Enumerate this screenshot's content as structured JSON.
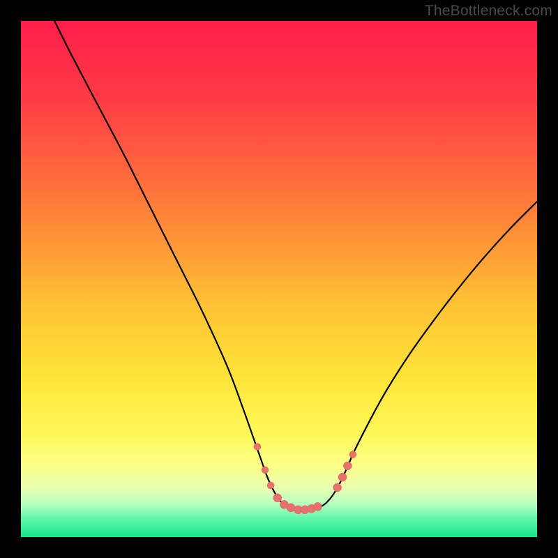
{
  "watermark": "TheBottleneck.com",
  "colors": {
    "black": "#000000",
    "curve": "#000000",
    "marker_fill": "#e9716b",
    "marker_stroke": "#d85f59"
  },
  "chart_data": {
    "type": "line",
    "title": "",
    "xlabel": "",
    "ylabel": "",
    "xlim": [
      0,
      100
    ],
    "ylim": [
      0,
      100
    ],
    "gradient_stops": [
      {
        "offset": 0.0,
        "color": "#ff1e49"
      },
      {
        "offset": 0.15,
        "color": "#ff3b45"
      },
      {
        "offset": 0.35,
        "color": "#ff7a3a"
      },
      {
        "offset": 0.55,
        "color": "#ffc233"
      },
      {
        "offset": 0.7,
        "color": "#ffe63a"
      },
      {
        "offset": 0.8,
        "color": "#fff85a"
      },
      {
        "offset": 0.86,
        "color": "#fdff87"
      },
      {
        "offset": 0.905,
        "color": "#e8ffb0"
      },
      {
        "offset": 0.935,
        "color": "#b8ffbf"
      },
      {
        "offset": 0.965,
        "color": "#5ef7a8"
      },
      {
        "offset": 1.0,
        "color": "#14e789"
      }
    ],
    "series": [
      {
        "name": "bottleneck-curve",
        "x": [
          6.5,
          10,
          15,
          20,
          25,
          30,
          35,
          40,
          43,
          46,
          48,
          50,
          52,
          54.5,
          57,
          59,
          61,
          63,
          65,
          70,
          75,
          80,
          85,
          90,
          95,
          100
        ],
        "y": [
          100,
          93,
          83.5,
          74,
          64,
          54,
          44,
          33,
          25,
          16.5,
          11,
          7.3,
          5.8,
          5.3,
          5.5,
          6.5,
          9,
          13,
          17.5,
          27,
          35,
          42,
          48.5,
          54.5,
          60,
          65
        ]
      }
    ],
    "markers": [
      {
        "x": 45.8,
        "y": 17.5,
        "r": 5
      },
      {
        "x": 47.3,
        "y": 13.0,
        "r": 5
      },
      {
        "x": 48.4,
        "y": 10.0,
        "r": 5
      },
      {
        "x": 49.7,
        "y": 7.6,
        "r": 6
      },
      {
        "x": 51.0,
        "y": 6.3,
        "r": 6
      },
      {
        "x": 52.3,
        "y": 5.7,
        "r": 6
      },
      {
        "x": 53.7,
        "y": 5.3,
        "r": 6
      },
      {
        "x": 55.0,
        "y": 5.3,
        "r": 6
      },
      {
        "x": 56.3,
        "y": 5.5,
        "r": 6
      },
      {
        "x": 57.5,
        "y": 5.9,
        "r": 6
      },
      {
        "x": 61.3,
        "y": 9.6,
        "r": 6
      },
      {
        "x": 62.3,
        "y": 11.6,
        "r": 6
      },
      {
        "x": 63.3,
        "y": 13.8,
        "r": 6
      },
      {
        "x": 64.3,
        "y": 16.0,
        "r": 5
      }
    ]
  }
}
